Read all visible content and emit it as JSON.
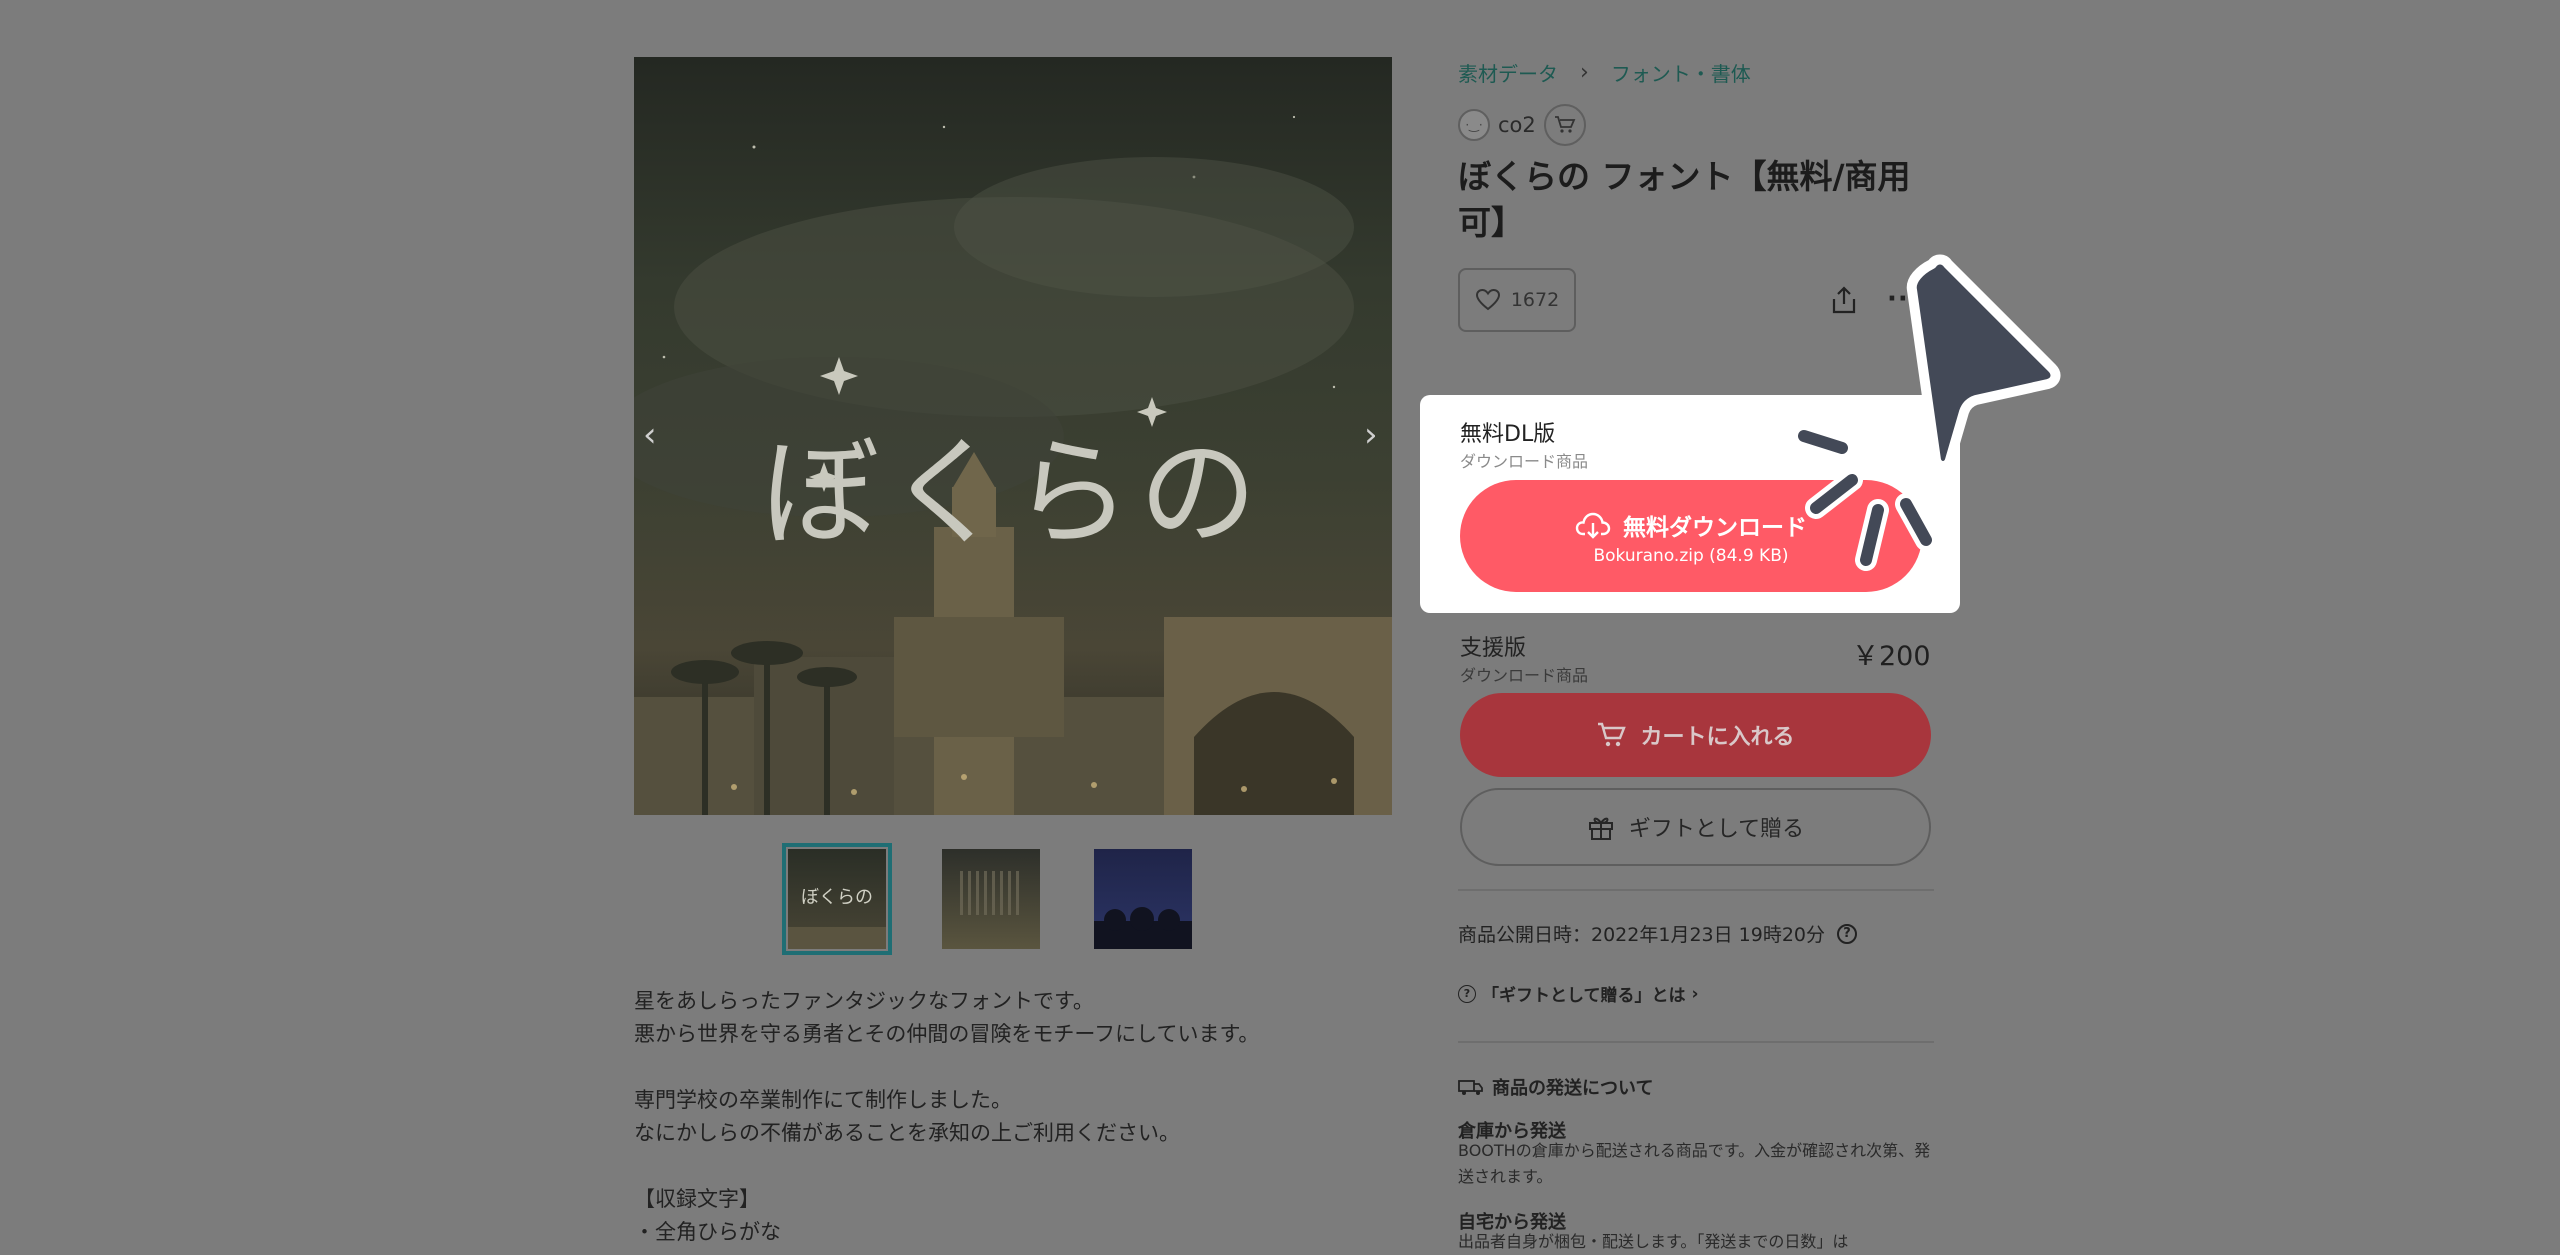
{
  "gallery": {
    "hero_text": "ぼくらの",
    "thumb_text": "ぼくらの"
  },
  "breadcrumb": {
    "items": [
      "素材データ",
      "フォント・書体"
    ],
    "separator": "›"
  },
  "shop": {
    "name": "co2",
    "avatar_text": "·‿·"
  },
  "product": {
    "title": "ぼくらの フォント【無料/商用可】",
    "like_count": "1672"
  },
  "variants": {
    "free": {
      "name": "無料DL版",
      "type": "ダウンロード商品",
      "button_label": "無料ダウンロード",
      "file": "Bokurano.zip (84.9 KB)"
    },
    "support": {
      "name": "支援版",
      "type": "ダウンロード商品",
      "price": "￥200",
      "cart_label": "カートに入れる",
      "gift_label": "ギフトとして贈る"
    }
  },
  "meta": {
    "published": "商品公開日時：2022年1月23日 19時20分",
    "gift_link": "「ギフトとして贈る」とは",
    "help_mark": "?"
  },
  "shipping": {
    "title": "商品の発送について",
    "warehouse_heading": "倉庫から発送",
    "warehouse_text": "BOOTHの倉庫から配送される商品です。入金が確認され次第、発送されます。",
    "home_heading": "自宅から発送",
    "home_text": "出品者自身が梱包・配送します。「発送までの日数」は"
  },
  "description": {
    "text": "星をあしらったファンタジックなフォントです。\n悪から世界を守る勇者とその仲間の冒険をモチーフにしています。\n\n専門学校の卒業制作にて制作しました。\nなにかしらの不備があることを承知の上ご利用ください。\n\n【収録文字】\n・全角ひらがな"
  },
  "colors": {
    "overlay": "#7c7c7c",
    "download_button": "#ff5a66",
    "cart_button_dimmed": "#a8363d",
    "breadcrumb_link": "#1e5a52",
    "cursor": "#434957"
  }
}
